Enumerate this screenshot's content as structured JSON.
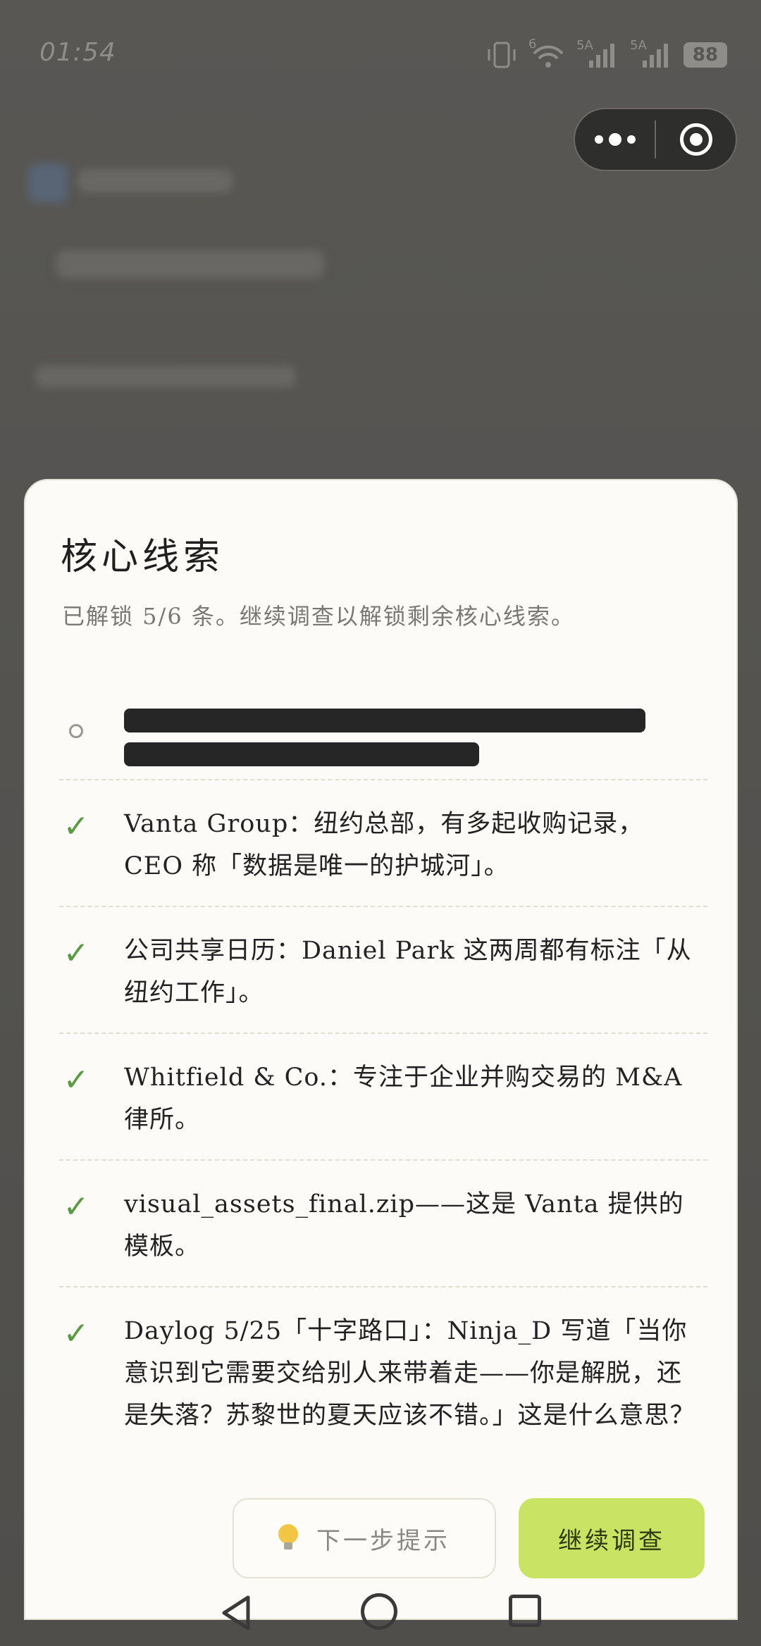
{
  "status_bar": {
    "time": "01:54",
    "signal1_label": "5A",
    "signal2_label": "5A",
    "wifi_label": "6",
    "battery": "88"
  },
  "sheet": {
    "title": "核心线索",
    "subtitle": "已解锁 5/6 条。继续调查以解锁剩余核心线索。",
    "clues": [
      {
        "locked": true,
        "text": ""
      },
      {
        "locked": false,
        "text": "Vanta Group：纽约总部，有多起收购记录，CEO 称「数据是唯一的护城河」。"
      },
      {
        "locked": false,
        "text": "公司共享日历：Daniel Park 这两周都有标注「从纽约工作」。"
      },
      {
        "locked": false,
        "text": "Whitfield & Co.：专注于企业并购交易的 M&A 律所。"
      },
      {
        "locked": false,
        "text": "visual_assets_final.zip——这是 Vanta 提供的模板。"
      },
      {
        "locked": false,
        "text": "Daylog 5/25「十字路口」：Ninja_D 写道「当你意识到它需要交给别人来带着走——你是解脱，还是失落？苏黎世的夏天应该不错。」这是什么意思？"
      }
    ],
    "hint_button": "下一步提示",
    "continue_button": "继续调查"
  },
  "colors": {
    "accent_green": "#c9e365",
    "check_green": "#5a9a43",
    "overlay": "#5a5956"
  },
  "icons": {
    "more": "more-dots-icon",
    "close": "close-target-icon",
    "check": "check-icon",
    "locked": "circle-icon",
    "hint": "lightbulb-icon",
    "back": "back-triangle-icon",
    "home": "home-circle-icon",
    "recent": "recent-square-icon"
  }
}
